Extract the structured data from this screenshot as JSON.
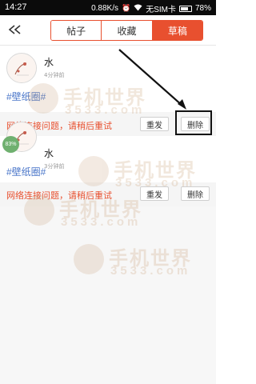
{
  "status_bar": {
    "time": "14:27",
    "speed": "0.88K/s",
    "sim": "无SIM卡",
    "battery": "78%",
    "battery_level": 0.78
  },
  "header": {
    "back_icon": "back-arrow-icon",
    "tabs": [
      {
        "label": "帖子",
        "active": false
      },
      {
        "label": "收藏",
        "active": false
      },
      {
        "label": "草稿",
        "active": true
      }
    ]
  },
  "posts": [
    {
      "author": "水",
      "time": "4分钟前",
      "tag": "#壁纸圈#",
      "error": "网络连接问题，请稍后重试",
      "resend_label": "重发",
      "delete_label": "删除"
    },
    {
      "author": "水",
      "time": "3分钟前",
      "tag": "#壁纸圈#",
      "error": "网络连接问题，请稍后重试",
      "resend_label": "重发",
      "delete_label": "删除",
      "progress_badge": "83%"
    }
  ],
  "watermark": {
    "title": "手机世界",
    "number": "3533.com"
  },
  "colors": {
    "accent": "#e8502f",
    "tag": "#4a76c9"
  }
}
